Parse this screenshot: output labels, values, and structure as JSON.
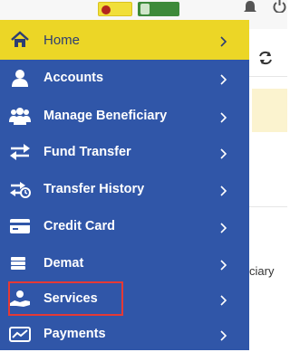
{
  "menu": {
    "items": [
      {
        "label": "Home",
        "icon": "home-icon"
      },
      {
        "label": "Accounts",
        "icon": "user-icon"
      },
      {
        "label": "Manage Beneficiary",
        "icon": "users-icon"
      },
      {
        "label": "Fund Transfer",
        "icon": "transfer-arrows-icon"
      },
      {
        "label": "Transfer History",
        "icon": "history-transfer-icon"
      },
      {
        "label": "Credit Card",
        "icon": "credit-card-icon"
      },
      {
        "label": "Demat",
        "icon": "stack-icon"
      },
      {
        "label": "Services",
        "icon": "services-hand-icon"
      },
      {
        "label": "Payments",
        "icon": "payments-icon"
      }
    ],
    "active_item": "Home",
    "highlighted_item": "Services"
  },
  "background": {
    "partial_text": "ciary"
  },
  "colors": {
    "menu_bg": "#3056a8",
    "active_bg": "#ecd626",
    "highlight_border": "#e53935"
  }
}
